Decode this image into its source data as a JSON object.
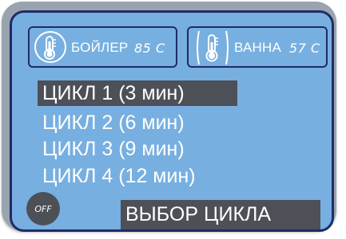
{
  "sensors": {
    "boiler": {
      "label": "БОЙЛЕР",
      "value": "85 C",
      "icon": "thermometer-icon"
    },
    "bath": {
      "label": "ВАННА",
      "value": "57 C",
      "icon": "thermometer-icon"
    }
  },
  "menu": {
    "items": [
      {
        "label": "ЦИКЛ 1 (3 мин)",
        "selected": true
      },
      {
        "label": "ЦИКЛ 2 (6 мин)",
        "selected": false
      },
      {
        "label": "ЦИКЛ 3 (9 мин)",
        "selected": false
      },
      {
        "label": "ЦИКЛ 4 (12 мин)",
        "selected": false
      }
    ]
  },
  "off_button": {
    "label": "OFF"
  },
  "status": {
    "text": "ВЫБОР ЦИКЛА"
  },
  "colors": {
    "screen_bg": "#77afe0",
    "screen_border": "#1f2c66",
    "highlight": "#4d5057",
    "text": "#ffffff"
  }
}
